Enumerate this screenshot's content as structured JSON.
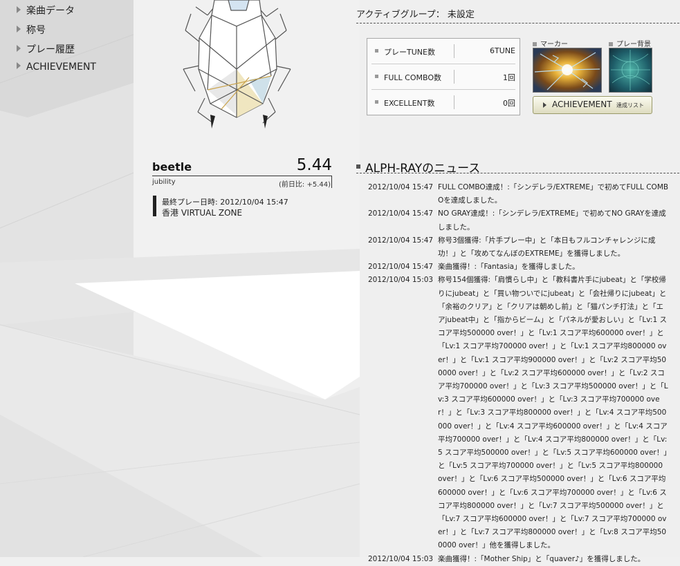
{
  "sidebar": {
    "items": [
      {
        "label": "楽曲データ"
      },
      {
        "label": "称号"
      },
      {
        "label": "プレー履歴"
      },
      {
        "label": "ACHIEVEMENT"
      }
    ]
  },
  "active_group": {
    "label": "アクティブグループ： 未設定"
  },
  "stats": [
    {
      "label": "プレーTUNE数",
      "value": "6TUNE"
    },
    {
      "label": "FULL COMBO数",
      "value": "1回"
    },
    {
      "label": "EXCELLENT数",
      "value": "0回"
    }
  ],
  "marker": {
    "label": "マーカー"
  },
  "play_background": {
    "label": "プレー背景"
  },
  "achievement_button": {
    "label": "ACHIEVEMENT",
    "sub_label": "達成リスト"
  },
  "profile": {
    "name": "beetle",
    "rating": "5.44",
    "rating_label": "jubility",
    "diff": "(前日比: +5.44)",
    "last_play": "最終プレー日時: 2012/10/04 15:47",
    "shop": "香港 VIRTUAL ZONE"
  },
  "news": {
    "title": "ALPH-RAYのニュース",
    "items": [
      {
        "date": "2012/10/04 15:47",
        "text": "FULL COMBO達成！:「シンデレラ/EXTREME」で初めてFULL COMBOを達成しました。"
      },
      {
        "date": "2012/10/04 15:47",
        "text": "NO GRAY達成！:「シンデレラ/EXTREME」で初めてNO GRAYを達成しました。"
      },
      {
        "date": "2012/10/04 15:47",
        "text": "称号3個獲得:「片手プレー中」と「本日もフルコンチャレンジに成功！」と「攻めてなんぼのEXTREME」を獲得しました。"
      },
      {
        "date": "2012/10/04 15:47",
        "text": "楽曲獲得！:「Fantasia」を獲得しました。"
      },
      {
        "date": "2012/10/04 15:03",
        "text": "称号154個獲得:「肩慣らし中」と「教科書片手にjubeat」と「学校帰りにjubeat」と「買い物ついでにjubeat」と「会社帰りにjubeat」と「余裕のクリア」と「クリアは朝めし前」と「猫パンチ打法」と「エアjubeat中」と「指からビーム」と「パネルが愛おしい」と「Lv:1 スコア平均500000 over！」と「Lv:1 スコア平均600000 over！」と「Lv:1 スコア平均700000 over！」と「Lv:1 スコア平均800000 over！」と「Lv:1 スコア平均900000 over！」と「Lv:2 スコア平均500000 over！」と「Lv:2 スコア平均600000 over！」と「Lv:2 スコア平均700000 over！」と「Lv:3 スコア平均500000 over！」と「Lv:3 スコア平均600000 over！」と「Lv:3 スコア平均700000 over！」と「Lv:3 スコア平均800000 over！」と「Lv:4 スコア平均500000 over！」と「Lv:4 スコア平均600000 over！」と「Lv:4 スコア平均700000 over！」と「Lv:4 スコア平均800000 over！」と「Lv:5 スコア平均500000 over！」と「Lv:5 スコア平均600000 over！」と「Lv:5 スコア平均700000 over！」と「Lv:5 スコア平均800000 over！」と「Lv:6 スコア平均500000 over！」と「Lv:6 スコア平均600000 over！」と「Lv:6 スコア平均700000 over！」と「Lv:6 スコア平均800000 over！」と「Lv:7 スコア平均500000 over！」と「Lv:7 スコア平均600000 over！」と「Lv:7 スコア平均700000 over！」と「Lv:7 スコア平均800000 over！」と「Lv:8 スコア平均500000 over！」他を獲得しました。"
      },
      {
        "date": "2012/10/04 15:03",
        "text": "楽曲獲得！:「Mother Ship」と「quaver♪」を獲得しました。"
      }
    ]
  }
}
